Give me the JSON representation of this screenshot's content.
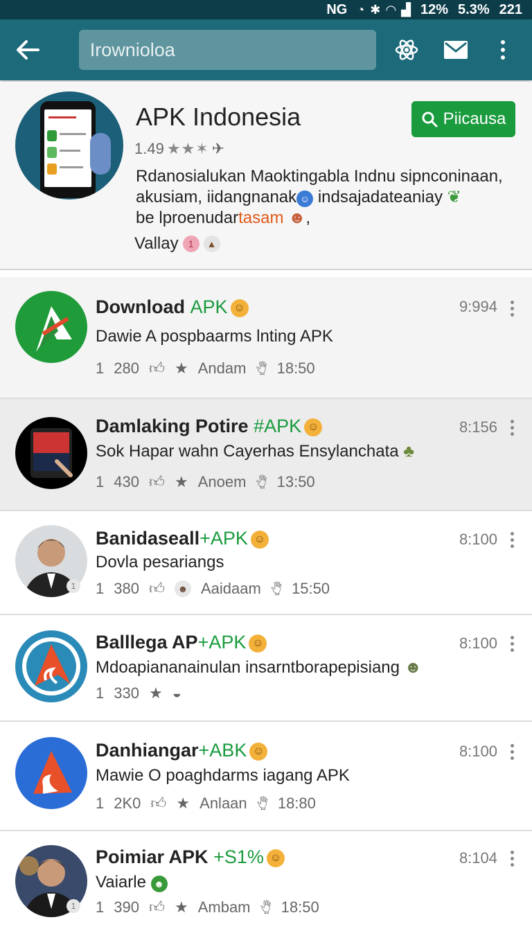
{
  "status_bar": {
    "carrier": "NG",
    "battery_a": "12%",
    "battery_b": "5.3%",
    "time": "221"
  },
  "app_bar": {
    "back_icon": "arrow-left-icon",
    "search_value": "Irownioloa",
    "icons": [
      "atom-icon",
      "mail-icon",
      "more-vert-icon"
    ]
  },
  "header": {
    "title": "APK Indonesia",
    "rating": "1.49",
    "install_label": "Piicausa",
    "desc_line1": "Rdanosialukan Maoktingabla Indnu sipnconinaan,",
    "desc_line2": "akusiam, iidangnanak",
    "desc_line2b": "indsajadateaniay",
    "desc_line3": "be lproenudar",
    "desc_line3_orange": "tasam",
    "tag": "Vallay",
    "tag_count": "1"
  },
  "items": [
    {
      "title": "Download",
      "title_green": "APK",
      "time": "9:994",
      "subtitle": "Dawie A pospbaarms lnting APK",
      "count": "1",
      "number": "280",
      "label": "Andam",
      "timestamp": "18:50"
    },
    {
      "title": "Damlaking Potire",
      "title_green": "#APK",
      "time": "8:156",
      "subtitle": "Sok Hapar wahn Cayerhas Ensylanchata",
      "count": "1",
      "number": "430",
      "label": "Anoem",
      "timestamp": "13:50"
    },
    {
      "title": "Banidaseall",
      "title_green": "+APK",
      "time": "8:100",
      "subtitle": "Dovla pesariangs",
      "count": "1",
      "number": "380",
      "label": "Aaidaam",
      "timestamp": "15:50"
    },
    {
      "title": "Balllega AP",
      "title_green": "+APK",
      "time": "8:100",
      "subtitle": "Mdoapiananainulan insarntborapepisiang",
      "count": "1",
      "number": "330",
      "label": "",
      "timestamp": ""
    },
    {
      "title": "Danhiangar",
      "title_green": "+ABK",
      "time": "8:100",
      "subtitle": "Mawie O poaghdarms iagang APK",
      "count": "1",
      "number": "2K0",
      "label": "Anlaan",
      "timestamp": "18:80"
    },
    {
      "title": "Poimiar APK",
      "title_green": "+S1%",
      "time": "8:104",
      "subtitle": "Vaiarle",
      "count": "1",
      "number": "390",
      "label": "Ambam",
      "timestamp": "18:50"
    }
  ],
  "colors": {
    "app_bar": "#1c6a7a",
    "status_bar": "#0e3d4a",
    "accent_green": "#1a9b3e"
  }
}
